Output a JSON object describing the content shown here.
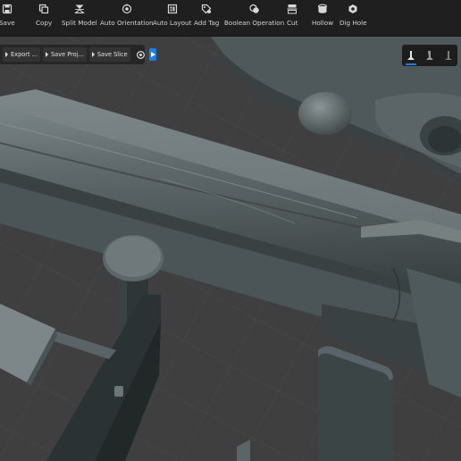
{
  "toolbar": {
    "items": [
      {
        "label": "Save",
        "icon": "save-icon"
      },
      {
        "label": "Copy",
        "icon": "copy-icon"
      },
      {
        "label": "Split Model",
        "icon": "split-model-icon"
      },
      {
        "label": "Auto Orientation",
        "icon": "auto-orientation-icon"
      },
      {
        "label": "Auto Layout",
        "icon": "auto-layout-icon"
      },
      {
        "label": "Add Tag",
        "icon": "tag-icon"
      },
      {
        "label": "Boolean Operation",
        "icon": "boolean-icon"
      },
      {
        "label": "Cut",
        "icon": "cut-icon"
      },
      {
        "label": "Hollow",
        "icon": "hollow-icon"
      },
      {
        "label": "Dig Hole",
        "icon": "dig-hole-icon"
      }
    ]
  },
  "actions": {
    "export_label": "Export ...",
    "save_project_label": "Save Proj...",
    "save_slice_label": "Save Slice",
    "settings_icon": "gear-icon",
    "play_icon": "play-icon"
  },
  "view_modes": {
    "icons": [
      "view-mode-1-icon",
      "view-mode-2-icon",
      "view-mode-3-icon"
    ],
    "active_index": 0
  },
  "colors": {
    "toolbar_bg": "#1f1f1f",
    "accent": "#1f7fe0",
    "viewport_bg": "#3e3e3e",
    "model": "#5c6668"
  }
}
